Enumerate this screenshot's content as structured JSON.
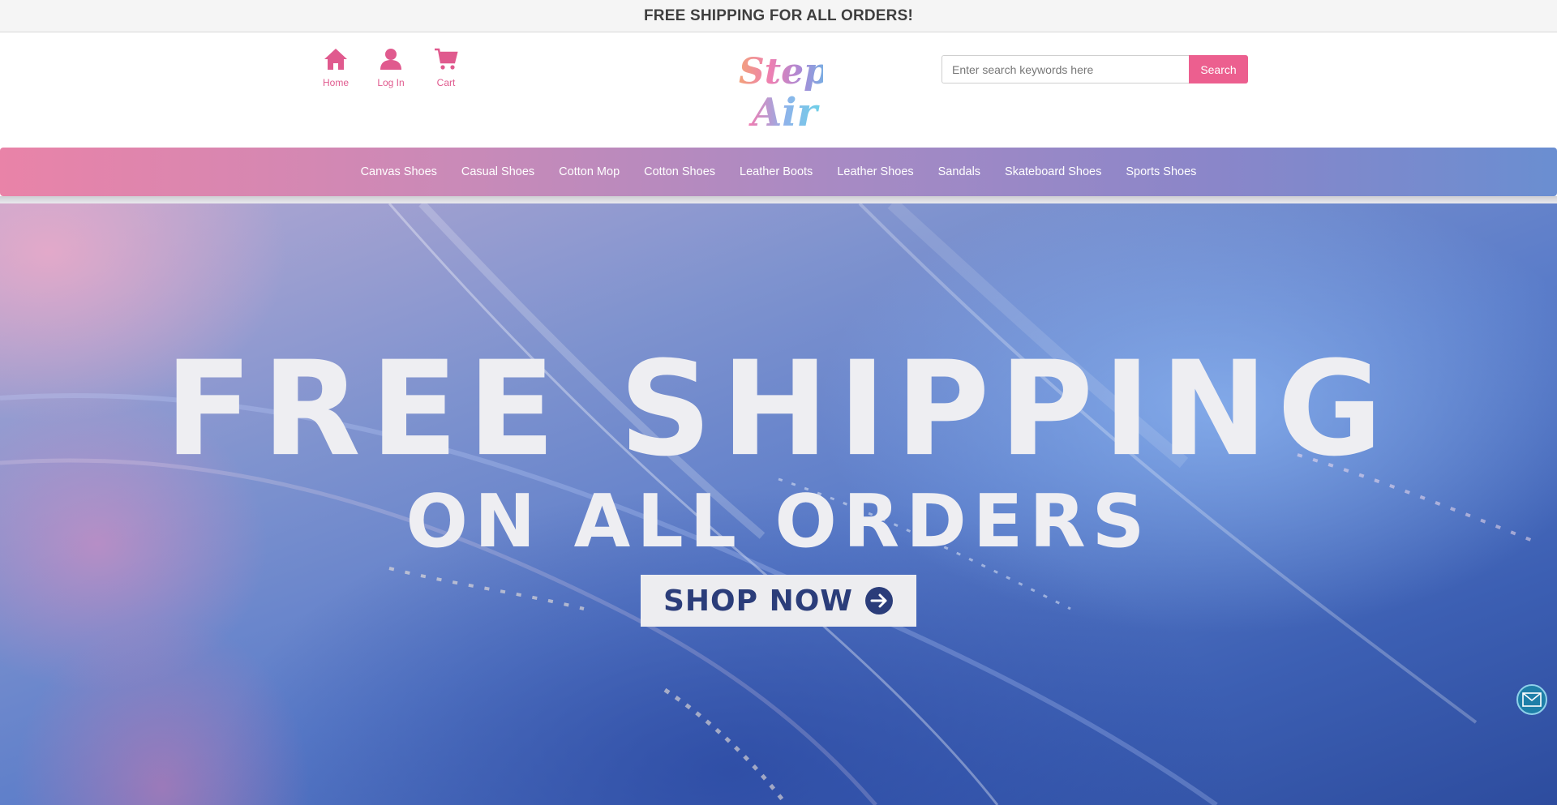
{
  "announcement": {
    "text": "FREE SHIPPING FOR ALL ORDERS!"
  },
  "header": {
    "quick_links": [
      {
        "label": "Home",
        "icon": "home-icon"
      },
      {
        "label": "Log In",
        "icon": "user-icon"
      },
      {
        "label": "Cart",
        "icon": "cart-icon"
      }
    ],
    "logo": {
      "text_line1": "Step",
      "text_line2": "Air"
    },
    "search": {
      "placeholder": "Enter search keywords here",
      "value": "",
      "button_label": "Search"
    }
  },
  "nav": {
    "items": [
      {
        "label": "Canvas Shoes"
      },
      {
        "label": "Casual Shoes"
      },
      {
        "label": "Cotton Mop"
      },
      {
        "label": "Cotton Shoes"
      },
      {
        "label": "Leather Boots"
      },
      {
        "label": "Leather Shoes"
      },
      {
        "label": "Sandals"
      },
      {
        "label": "Skateboard Shoes"
      },
      {
        "label": "Sports Shoes"
      }
    ]
  },
  "hero": {
    "title": "FREE SHIPPING",
    "subtitle": "ON ALL ORDERS",
    "cta_label": "SHOP NOW"
  },
  "chat": {
    "icon": "mail-icon"
  },
  "colors": {
    "accent": "#ec5f8f",
    "icon_pink": "#e05a8e",
    "nav_gradient_start": "#e983a8",
    "nav_gradient_end": "#6a8ed1",
    "cta_text": "#2b3d7a"
  }
}
